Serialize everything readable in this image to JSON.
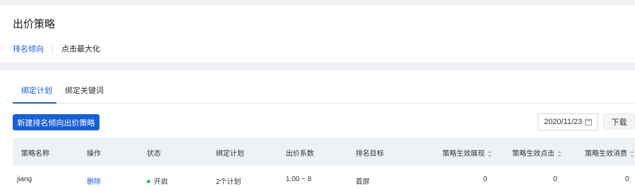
{
  "header": {
    "title": "出价策略",
    "subnav": {
      "active": "排名倾向",
      "other": "点击最大化"
    }
  },
  "tabs": [
    "绑定计划",
    "绑定关键词"
  ],
  "toolbar": {
    "new_button": "新建排名倾向出价策略",
    "date": "2020/11/23",
    "download": "下载"
  },
  "table": {
    "columns": [
      "策略名称",
      "操作",
      "状态",
      "绑定计划",
      "出价系数",
      "排名目标",
      "策略生效展现",
      "策略生效点击",
      "策略生效消费"
    ],
    "rows": [
      {
        "name": "jiang",
        "action": "删除",
        "status": "开启",
        "plans": "2个计划",
        "coef": "1.00 ~ 8",
        "target": "首屏",
        "impressions": "0",
        "clicks": "0",
        "cost": "0"
      }
    ]
  },
  "colors": {
    "accent": "#1a5fd6",
    "status_on": "#2fbf4a"
  }
}
